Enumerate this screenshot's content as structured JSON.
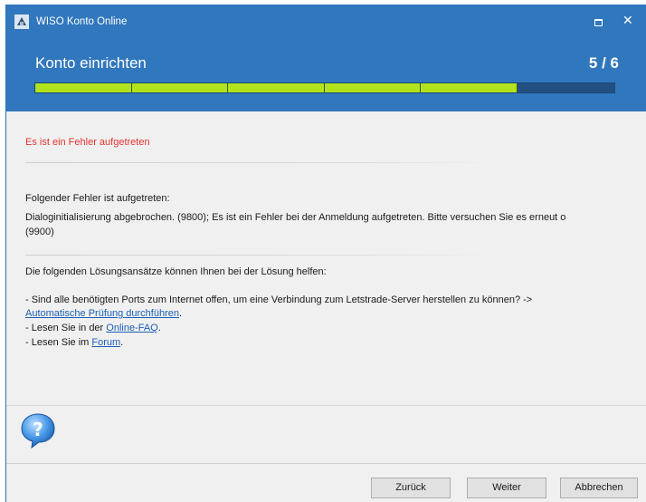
{
  "titlebar": {
    "app_title": "WISO Konto Online",
    "maximize_glyph": "",
    "close_glyph": "✕"
  },
  "header": {
    "title": "Konto einrichten",
    "step": "5 / 6",
    "progress": {
      "completed_segments": 5,
      "total_segments": 6,
      "fill_color": "#b1e21c"
    }
  },
  "content": {
    "error_title": "Es ist ein Fehler aufgetreten",
    "error_intro": "Folgender Fehler ist aufgetreten:",
    "error_detail_line1": "Dialoginitialisierung abgebrochen. (9800); Es ist ein Fehler bei der Anmeldung aufgetreten. Bitte versuchen Sie es erneut o",
    "error_detail_line2": "(9900)",
    "solutions_intro": "Die folgenden Lösungsansätze können Ihnen bei der Lösung helfen:",
    "solution1_text": "- Sind alle benötigten Ports zum Internet offen, um eine Verbindung zum Letstrade-Server herstellen zu können? ->",
    "solution1_link": "Automatische Prüfung durchführen",
    "solution1_suffix": ".",
    "solution2_prefix": "- Lesen Sie in der ",
    "solution2_link": "Online-FAQ",
    "solution2_suffix": ".",
    "solution3_prefix": "- Lesen Sie im ",
    "solution3_link": "Forum",
    "solution3_suffix": "."
  },
  "footer": {
    "help_icon": "question-mark-icon",
    "back_label": "Zurück",
    "next_label": "Weiter",
    "cancel_label": "Abbrechen"
  },
  "colors": {
    "header_bg": "#3177bd",
    "error_text": "#e3342f",
    "link": "#1a5fb4"
  }
}
